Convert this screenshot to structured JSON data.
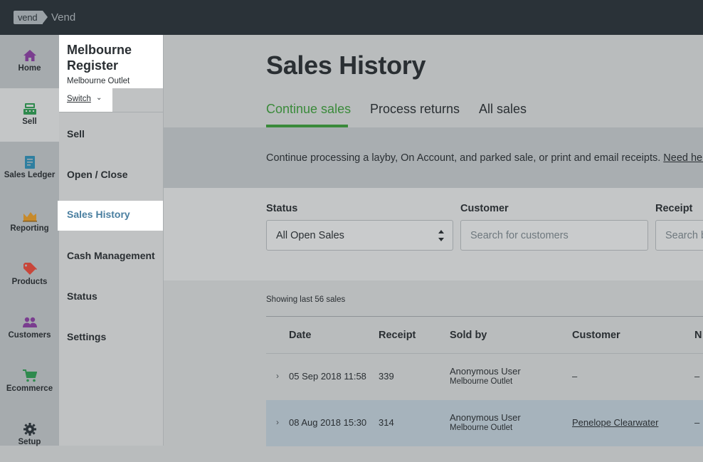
{
  "topbar": {
    "logo": "vend",
    "brand": "Vend"
  },
  "leftnav": [
    {
      "label": "Home",
      "icon": "home-icon",
      "color": "#7a3d8f"
    },
    {
      "label": "Sell",
      "icon": "register-icon",
      "color": "#2f8a4e",
      "active": true
    },
    {
      "label": "Sales Ledger",
      "icon": "ledger-icon",
      "color": "#2f7fa0"
    },
    {
      "label": "Reporting",
      "icon": "chart-icon",
      "color": "#c78a2b"
    },
    {
      "label": "Products",
      "icon": "tag-icon",
      "color": "#c8463a"
    },
    {
      "label": "Customers",
      "icon": "people-icon",
      "color": "#7a3d8f"
    },
    {
      "label": "Ecommerce",
      "icon": "cart-icon",
      "color": "#2f8a4e"
    },
    {
      "label": "Setup",
      "icon": "gear-icon",
      "color": "#2a3238"
    }
  ],
  "register": {
    "name": "Melbourne Register",
    "outlet": "Melbourne Outlet",
    "switch_label": "Switch"
  },
  "subnav": [
    "Sell",
    "Open / Close",
    "Sales History",
    "Cash Management",
    "Status",
    "Settings"
  ],
  "subnav_active": "Sales History",
  "page": {
    "title": "Sales History",
    "tabs": [
      "Continue sales",
      "Process returns",
      "All sales"
    ],
    "active_tab": "Continue sales",
    "info_text": "Continue processing a layby, On Account, and parked sale, or print and email receipts.",
    "info_link": "Need hel"
  },
  "filters": {
    "status_label": "Status",
    "status_value": "All Open Sales",
    "customer_label": "Customer",
    "customer_placeholder": "Search for customers",
    "receipt_label": "Receipt",
    "receipt_placeholder": "Search b"
  },
  "list": {
    "showing": "Showing last 56 sales",
    "columns": [
      "Date",
      "Receipt",
      "Sold by",
      "Customer",
      "N"
    ],
    "rows": [
      {
        "date": "05 Sep 2018 11:58",
        "receipt": "339",
        "sold_by": "Anonymous User",
        "outlet": "Melbourne Outlet",
        "customer": "–",
        "note": "–"
      },
      {
        "date": "08 Aug 2018 15:30",
        "receipt": "314",
        "sold_by": "Anonymous User",
        "outlet": "Melbourne Outlet",
        "customer": "Penelope Clearwater",
        "note": "–"
      }
    ]
  },
  "colors": {
    "accent_green": "#3a8a3a",
    "topbar": "#2a3238",
    "active_sub": "#4a7fa0"
  }
}
